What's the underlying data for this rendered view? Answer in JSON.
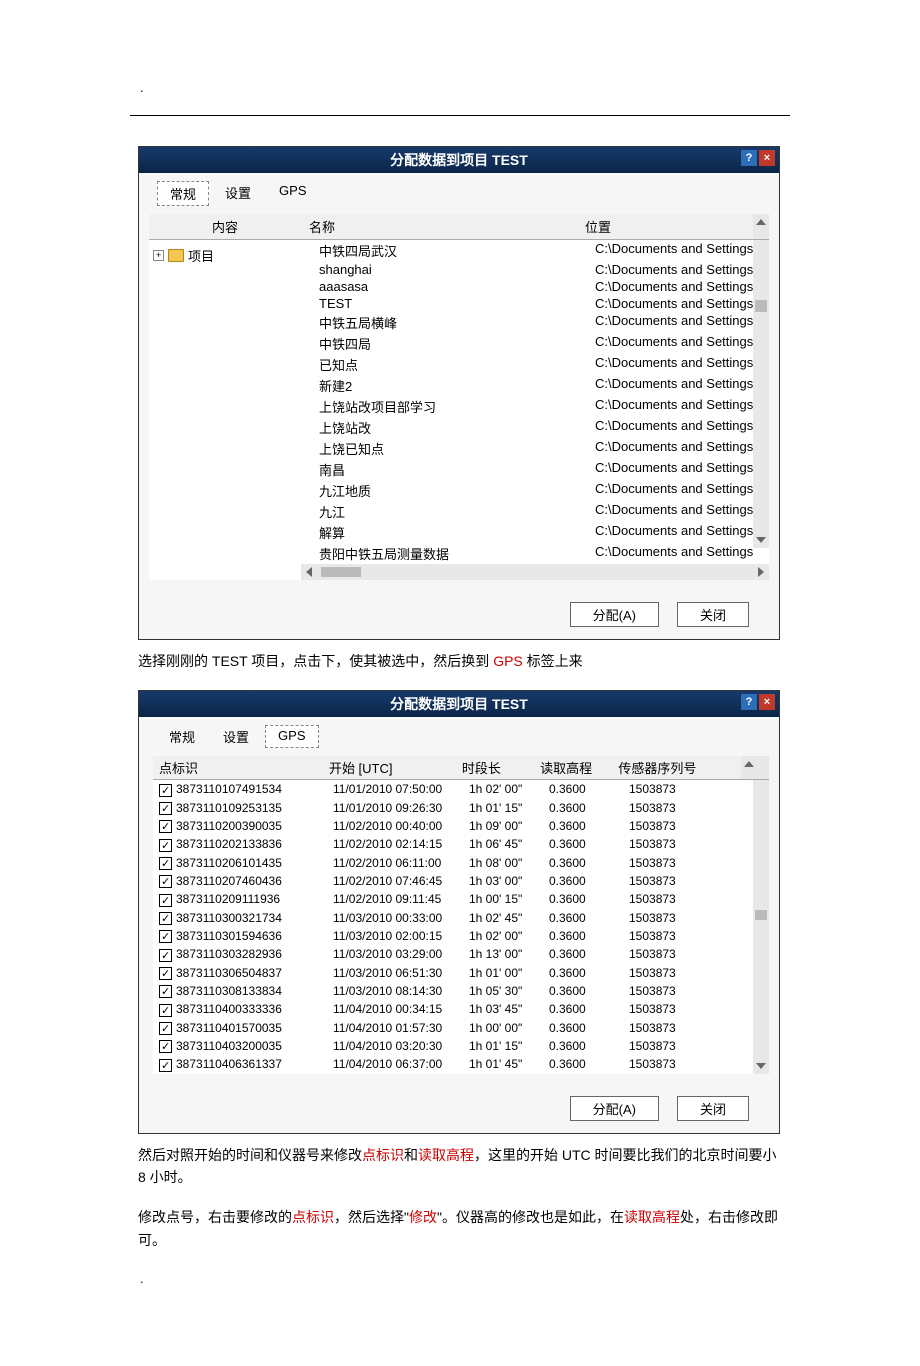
{
  "dialog1": {
    "title": "分配数据到项目 TEST",
    "tabs": {
      "general": "常规",
      "settings": "设置",
      "gps": "GPS"
    },
    "left_header": "内容",
    "tree_root": "项目",
    "cols": {
      "name": "名称",
      "location": "位置"
    },
    "items": [
      {
        "name": "中铁四局武汉",
        "loc": "C:\\Documents and Settings"
      },
      {
        "name": "shanghai",
        "loc": "C:\\Documents and Settings"
      },
      {
        "name": "aaasasa",
        "loc": "C:\\Documents and Settings"
      },
      {
        "name": "TEST",
        "loc": "C:\\Documents and Settings"
      },
      {
        "name": "中铁五局横峰",
        "loc": "C:\\Documents and Settings"
      },
      {
        "name": "中铁四局",
        "loc": "C:\\Documents and Settings"
      },
      {
        "name": "已知点",
        "loc": "C:\\Documents and Settings"
      },
      {
        "name": "新建2",
        "loc": "C:\\Documents and Settings"
      },
      {
        "name": "上饶站改项目部学习",
        "loc": "C:\\Documents and Settings"
      },
      {
        "name": "上饶站改",
        "loc": "C:\\Documents and Settings"
      },
      {
        "name": "上饶已知点",
        "loc": "C:\\Documents and Settings"
      },
      {
        "name": "南昌",
        "loc": "C:\\Documents and Settings"
      },
      {
        "name": "九江地质",
        "loc": "C:\\Documents and Settings"
      },
      {
        "name": "九江",
        "loc": "C:\\Documents and Settings"
      },
      {
        "name": "解算",
        "loc": "C:\\Documents and Settings"
      },
      {
        "name": "贵阳中铁五局测量数据",
        "loc": "C:\\Documents and Settings"
      }
    ],
    "assign": "分配(A)",
    "close": "关闭"
  },
  "caption1": {
    "a": "选择刚刚的 TEST 项目，点击下，使其被选中，然后换到 ",
    "b": "GPS",
    "c": " 标签上来"
  },
  "dialog2": {
    "title": "分配数据到项目 TEST",
    "tabs": {
      "general": "常规",
      "settings": "设置",
      "gps": "GPS"
    },
    "cols": {
      "id": "点标识",
      "start": "开始 [UTC]",
      "dur": "时段长",
      "elev": "读取高程",
      "sn": "传感器序列号"
    },
    "rows": [
      {
        "id": "3873110107491534",
        "st": "11/01/2010 07:50:00",
        "du": "1h 02' 00\"",
        "el": "0.3600",
        "sn": "1503873"
      },
      {
        "id": "3873110109253135",
        "st": "11/01/2010 09:26:30",
        "du": "1h 01' 15\"",
        "el": "0.3600",
        "sn": "1503873"
      },
      {
        "id": "3873110200390035",
        "st": "11/02/2010 00:40:00",
        "du": "1h 09' 00\"",
        "el": "0.3600",
        "sn": "1503873"
      },
      {
        "id": "3873110202133836",
        "st": "11/02/2010 02:14:15",
        "du": "1h 06' 45\"",
        "el": "0.3600",
        "sn": "1503873"
      },
      {
        "id": "3873110206101435",
        "st": "11/02/2010 06:11:00",
        "du": "1h 08' 00\"",
        "el": "0.3600",
        "sn": "1503873"
      },
      {
        "id": "3873110207460436",
        "st": "11/02/2010 07:46:45",
        "du": "1h 03' 00\"",
        "el": "0.3600",
        "sn": "1503873"
      },
      {
        "id": "3873110209111936",
        "st": "11/02/2010 09:11:45",
        "du": "1h 00' 15\"",
        "el": "0.3600",
        "sn": "1503873"
      },
      {
        "id": "3873110300321734",
        "st": "11/03/2010 00:33:00",
        "du": "1h 02' 45\"",
        "el": "0.3600",
        "sn": "1503873"
      },
      {
        "id": "3873110301594636",
        "st": "11/03/2010 02:00:15",
        "du": "1h 02' 00\"",
        "el": "0.3600",
        "sn": "1503873"
      },
      {
        "id": "3873110303282936",
        "st": "11/03/2010 03:29:00",
        "du": "1h 13' 00\"",
        "el": "0.3600",
        "sn": "1503873"
      },
      {
        "id": "3873110306504837",
        "st": "11/03/2010 06:51:30",
        "du": "1h 01' 00\"",
        "el": "0.3600",
        "sn": "1503873"
      },
      {
        "id": "3873110308133834",
        "st": "11/03/2010 08:14:30",
        "du": "1h 05' 30\"",
        "el": "0.3600",
        "sn": "1503873"
      },
      {
        "id": "3873110400333336",
        "st": "11/04/2010 00:34:15",
        "du": "1h 03' 45\"",
        "el": "0.3600",
        "sn": "1503873"
      },
      {
        "id": "3873110401570035",
        "st": "11/04/2010 01:57:30",
        "du": "1h 00' 00\"",
        "el": "0.3600",
        "sn": "1503873"
      },
      {
        "id": "3873110403200035",
        "st": "11/04/2010 03:20:30",
        "du": "1h 01' 15\"",
        "el": "0.3600",
        "sn": "1503873"
      },
      {
        "id": "3873110406361337",
        "st": "11/04/2010 06:37:00",
        "du": "1h 01' 45\"",
        "el": "0.3600",
        "sn": "1503873"
      }
    ],
    "assign": "分配(A)",
    "close": "关闭"
  },
  "caption2": {
    "a": "然后对照开始的时间和仪器号来修改",
    "b": "点标识",
    "c": "和",
    "d": "读取高程",
    "e": "，这里的开始 UTC 时间要比我们的北京时间要小 8 小时。"
  },
  "caption3": {
    "a": "修改点号，右击要修改的",
    "b": "点标识",
    "c": "，然后选择\"",
    "d": "修改",
    "e": "\"。仪器高的修改也是如此，在",
    "f": "读取高程",
    "g": "处，右击修改即可。"
  }
}
